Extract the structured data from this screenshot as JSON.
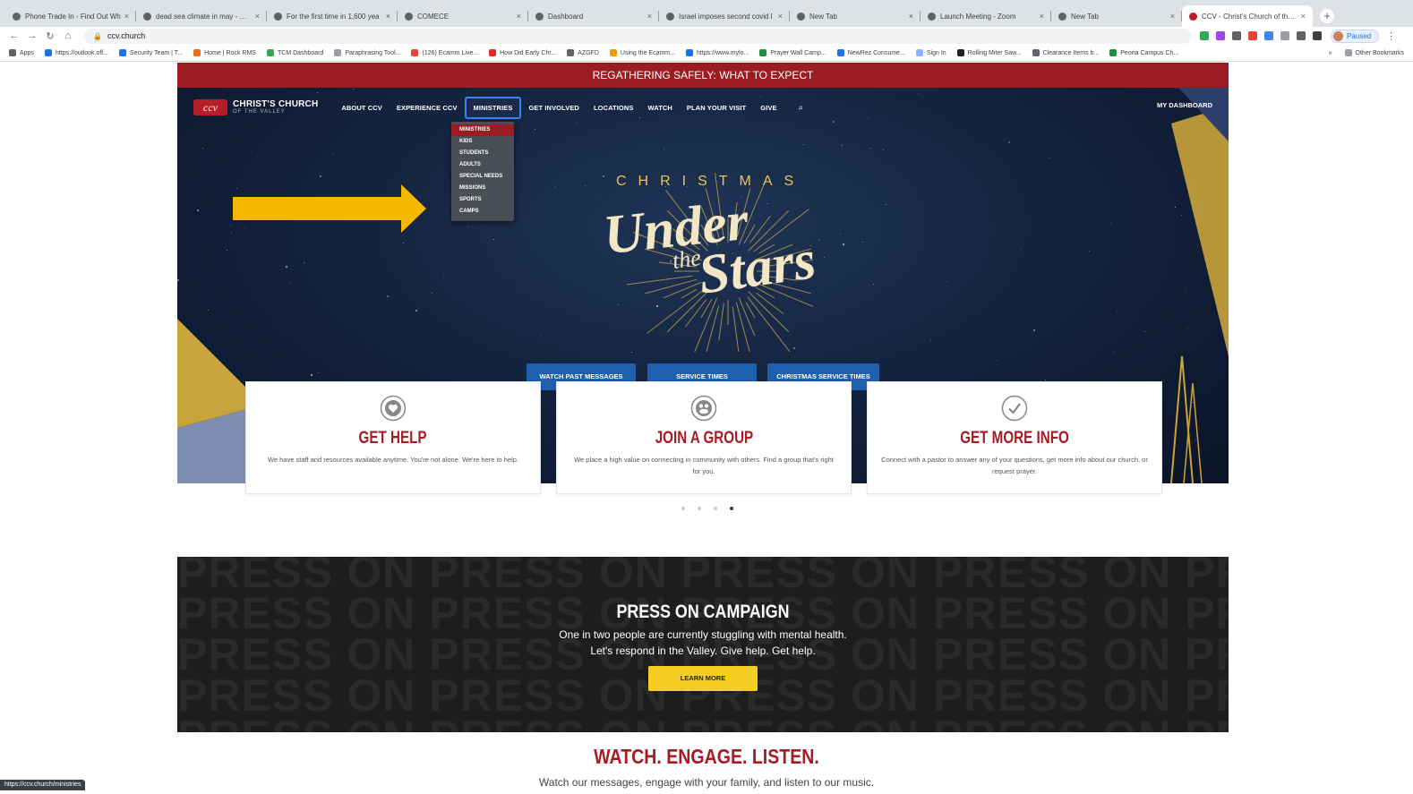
{
  "browser": {
    "tabs": [
      {
        "title": "Phone Trade In - Find Out Wh",
        "active": false
      },
      {
        "title": "dead sea climate in may - Goo",
        "active": false
      },
      {
        "title": "For the first time in 1,600 yea",
        "active": false
      },
      {
        "title": "COMECE",
        "active": false
      },
      {
        "title": "Dashboard",
        "active": false
      },
      {
        "title": "Israel imposes second covid l",
        "active": false
      },
      {
        "title": "New Tab",
        "active": false
      },
      {
        "title": "Launch Meeting - Zoom",
        "active": false
      },
      {
        "title": "New Tab",
        "active": false
      },
      {
        "title": "CCV - Christ's Church of the V",
        "active": true
      }
    ],
    "url": "ccv.church",
    "profile_label": "Paused",
    "bookmarks": [
      "Apps",
      "https://outlook.off...",
      "Security Team | T...",
      "Home | Rock RMS",
      "TCM Dashboard",
      "Paraphrasing Tool...",
      "(126) Ecamm Live...",
      "How Did Early Chr...",
      "AZGFD",
      "Using the Ecamm...",
      "https://www.mylo...",
      "Prayer Wall Camp...",
      "NewRez Consume...",
      "Sign In",
      "Rolling Miter Saw...",
      "Clearance Items b...",
      "Peoria Campus Ch..."
    ],
    "bookmarks_more": "»",
    "other_bookmarks": "Other Bookmarks",
    "status_url": "https://ccv.church/ministries"
  },
  "site": {
    "banner": "REGATHERING SAFELY: WHAT TO EXPECT",
    "logo_mark": "ccv",
    "logo_name": "CHRIST'S CHURCH",
    "logo_sub": "OF THE VALLEY",
    "nav": [
      "ABOUT CCV",
      "EXPERIENCE CCV",
      "MINISTRIES",
      "GET INVOLVED",
      "LOCATIONS",
      "WATCH",
      "PLAN YOUR VISIT",
      "GIVE"
    ],
    "dashboard": "MY DASHBOARD",
    "dropdown": [
      "MINISTRIES",
      "KIDS",
      "STUDENTS",
      "ADULTS",
      "SPECIAL NEEDS",
      "MISSIONS",
      "SPORTS",
      "CAMPS"
    ],
    "hero": {
      "eyebrow": "CHRISTMAS",
      "title_a": "Under",
      "title_the": "the",
      "title_b": "Stars"
    },
    "hero_buttons": [
      "WATCH PAST MESSAGES",
      "SERVICE TIMES",
      "CHRISTMAS SERVICE TIMES"
    ],
    "cards": [
      {
        "icon": "heart-icon",
        "title": "GET HELP",
        "text": "We have staff and resources available anytime. You're not alone. We're here to help."
      },
      {
        "icon": "group-icon",
        "title": "JOIN A GROUP",
        "text": "We place a high value on connecting in community with others. Find a group that's right for you."
      },
      {
        "icon": "check-icon",
        "title": "GET MORE INFO",
        "text": "Connect with a pastor to answer any of your questions, get more info about our church, or request prayer."
      }
    ],
    "carousel": {
      "count": 4,
      "active": 4
    },
    "press": {
      "background_word": "PRESS ON",
      "title": "PRESS ON CAMPAIGN",
      "line1": "One in two people are currently stuggling with mental health.",
      "line2": "Let's respond in the Valley. Give help. Get help.",
      "button": "LEARN MORE"
    },
    "watch_title": "WATCH. ENGAGE. LISTEN.",
    "watch_sub": "Watch our messages, engage with your family, and listen to our music."
  },
  "colors": {
    "brand_red": "#9b1c23",
    "accent_blue": "#1e5fae",
    "annotation_arrow": "#f5b800",
    "press_button": "#f5cd25"
  }
}
